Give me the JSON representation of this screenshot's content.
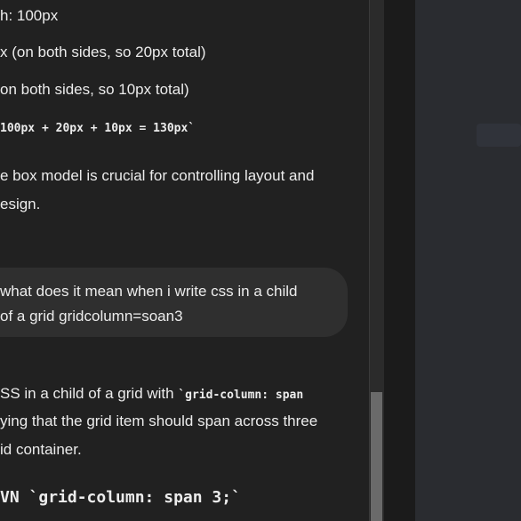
{
  "chat": {
    "lines": {
      "width": "h: 100px",
      "padding": "x (on both sides, so 20px total)",
      "border": "on both sides, so 10px total)",
      "total_code": "100px + 20px + 10px = 130px`",
      "summary_1": "e box model is crucial for controlling layout and",
      "summary_2": "esign."
    },
    "user_message": {
      "line_1": "what does it mean when i write css in a child",
      "line_2": "of a grid gridcolumn=soan3"
    },
    "response": {
      "line_1_text": "SS in a child of a grid with ",
      "line_1_code": "`grid-column: span",
      "line_2": "ying that the grid item should span across three",
      "line_3": "id container.",
      "heading_prefix": "VN ",
      "heading_code": "`grid-column: span 3;`"
    }
  },
  "colors": {
    "chat_background": "#212121",
    "user_bubble": "#2f2f2f",
    "text": "#ececec",
    "scrollbar_thumb": "#6a6a6a",
    "right_pane": "#2a2c30"
  }
}
